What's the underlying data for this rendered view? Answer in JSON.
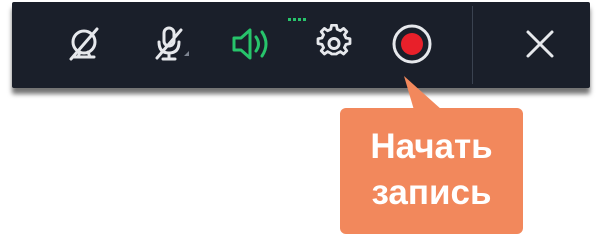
{
  "toolbar": {
    "icons": {
      "webcam": "webcam-off-icon",
      "microphone": "microphone-off-icon",
      "speaker": "speaker-on-icon",
      "settings": "gear-icon",
      "record": "record-icon",
      "close": "close-icon"
    },
    "colors": {
      "background": "#1a1f2a",
      "icon": "#e6e8ec",
      "speaker_active": "#27c46b",
      "record": "#e8202a"
    }
  },
  "callout": {
    "text": "Начать\nзапись",
    "color": "#f2885c"
  }
}
